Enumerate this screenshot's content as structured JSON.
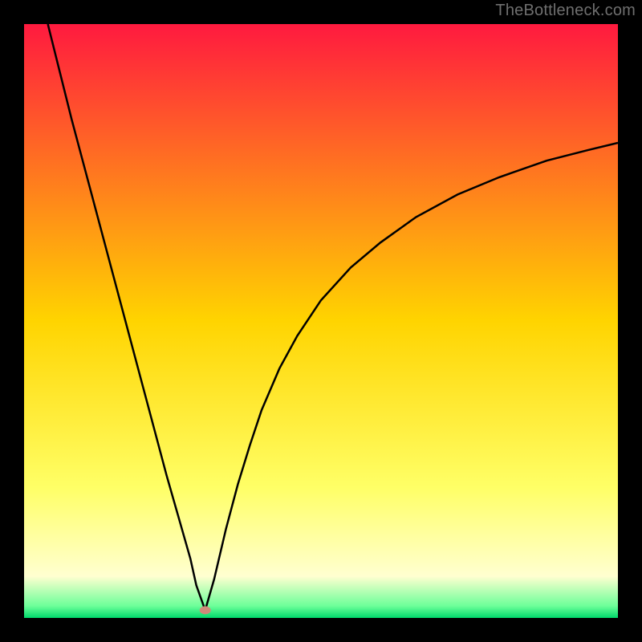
{
  "watermark": "TheBottleneck.com",
  "chart_data": {
    "type": "line",
    "title": "",
    "xlabel": "",
    "ylabel": "",
    "xlim": [
      0,
      100
    ],
    "ylim": [
      0,
      100
    ],
    "background_gradient": {
      "stops": [
        {
          "offset": 0.0,
          "color": "#ff1a3f"
        },
        {
          "offset": 0.5,
          "color": "#ffd400"
        },
        {
          "offset": 0.78,
          "color": "#ffff66"
        },
        {
          "offset": 0.93,
          "color": "#ffffd0"
        },
        {
          "offset": 0.98,
          "color": "#6cff99"
        },
        {
          "offset": 1.0,
          "color": "#00d96b"
        }
      ]
    },
    "series": [
      {
        "name": "bottleneck-curve",
        "x": [
          4.0,
          6.0,
          8.0,
          10.0,
          12.0,
          14.0,
          16.0,
          18.0,
          20.0,
          22.0,
          24.0,
          26.0,
          28.0,
          29.0,
          30.5,
          32.0,
          34.0,
          36.0,
          38.0,
          40.0,
          43.0,
          46.0,
          50.0,
          55.0,
          60.0,
          66.0,
          73.0,
          80.0,
          88.0,
          95.0,
          100.0
        ],
        "y": [
          100.0,
          92.0,
          84.0,
          76.5,
          69.0,
          61.5,
          54.0,
          46.5,
          39.0,
          31.5,
          24.0,
          17.0,
          10.0,
          5.5,
          1.3,
          6.5,
          15.0,
          22.5,
          29.0,
          35.0,
          42.0,
          47.5,
          53.5,
          59.0,
          63.2,
          67.5,
          71.3,
          74.2,
          77.0,
          78.8,
          80.0
        ]
      }
    ],
    "marker": {
      "x": 30.5,
      "y": 1.3,
      "color": "#cf8a79"
    }
  }
}
